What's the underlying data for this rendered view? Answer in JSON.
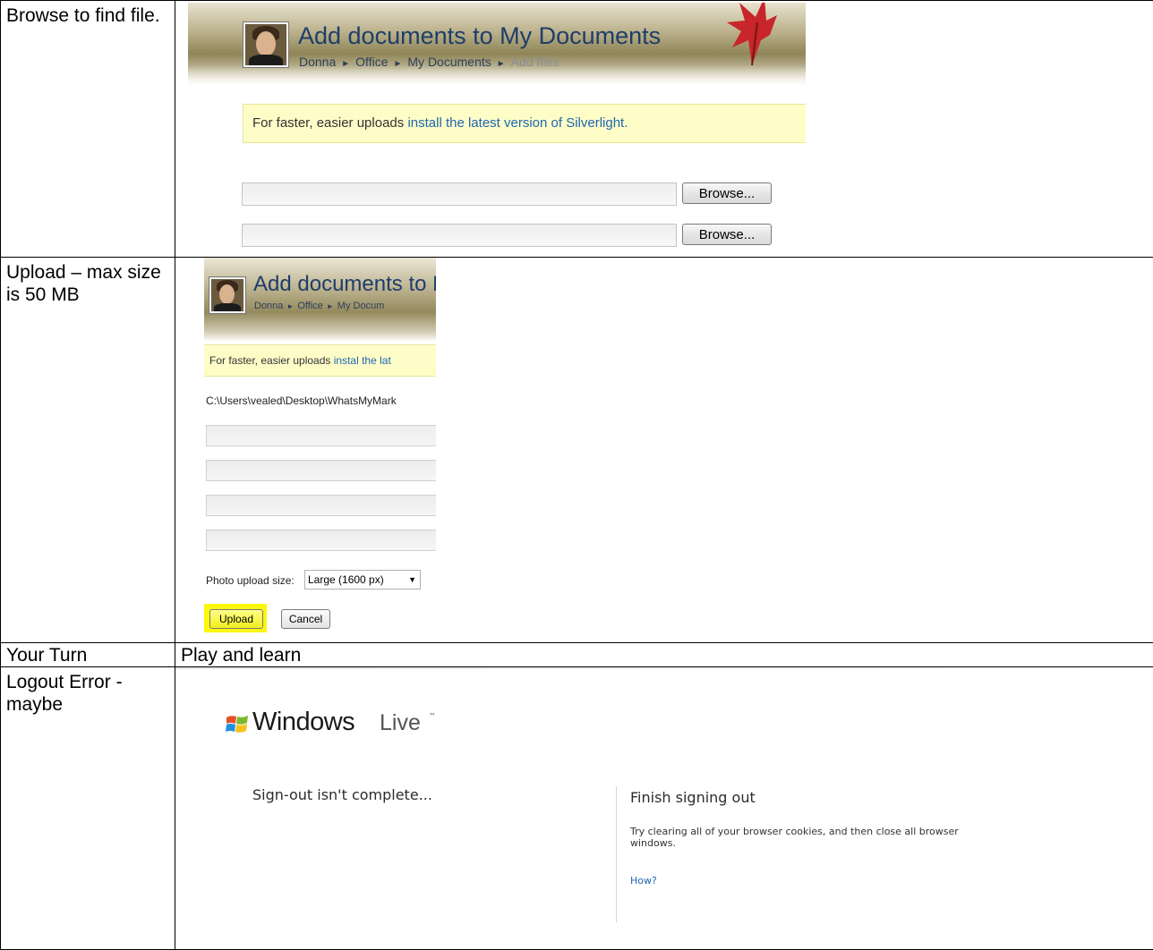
{
  "rows": [
    {
      "label": "Browse to find file.",
      "screenshot": {
        "page_title": "Add documents to My Documents",
        "breadcrumb": [
          "Donna",
          "Office",
          "My Documents",
          "Add files"
        ],
        "notice_text": "For faster, easier uploads ",
        "notice_link": "install the latest version of Silverlight.",
        "browse_buttons": [
          "Browse...",
          "Browse..."
        ]
      }
    },
    {
      "label": "Upload – max size is 50 MB",
      "screenshot": {
        "page_title": "Add documents to M",
        "breadcrumb": [
          "Donna",
          "Office",
          "My Docum"
        ],
        "notice_text": "For faster, easier uploads ",
        "notice_link": "instal the lat",
        "file_path": "C:\\Users\\vealed\\Desktop\\WhatsMyMark",
        "photo_size_label": "Photo upload size:",
        "photo_size_value": "Large (1600 px)",
        "upload_button": "Upload",
        "cancel_button": "Cancel",
        "highlight_color": "#fbf70d"
      }
    },
    {
      "label": "Your Turn",
      "text": "Play and learn"
    },
    {
      "label": "Logout Error - maybe",
      "screenshot": {
        "brand_windows": "Windows",
        "brand_live": "Live",
        "brand_tm": "™",
        "left_message": "Sign-out isn't complete...",
        "right_title": "Finish signing out",
        "right_body": "Try clearing all of your browser cookies, and then close all browser windows.",
        "how_link": "How?"
      }
    }
  ],
  "icons": {
    "breadcrumb_separator": "►",
    "dropdown_arrow": "▼",
    "logo": "windows-flag-icon",
    "avatar": "user-avatar-icon",
    "decoration": "red-leaf-icon"
  },
  "colors": {
    "link_blue": "#2067b0",
    "title_blue": "#1e3d6b",
    "notice_yellow": "#fefdc8"
  }
}
